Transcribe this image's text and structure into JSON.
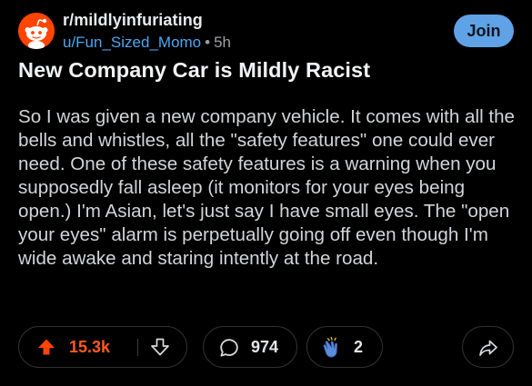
{
  "post": {
    "subreddit": "r/mildlyinfuriating",
    "author": "u/Fun_Sized_Momo",
    "separator": "•",
    "age": "5h",
    "join_label": "Join",
    "title": "New Company Car is Mildly Racist",
    "body": "So I was given a new company vehicle. It comes with all the bells and whistles, all the \"safety features\" one could ever need. One of these safety features is a warning when you supposedly fall asleep (it monitors for your eyes being open.) I'm Asian, let's just say I have small eyes. The \"open your eyes\" alarm is perpetually going off even though I'm wide awake and staring intently at the road."
  },
  "actions": {
    "upvotes": "15.3k",
    "comments": "974",
    "awards": "2"
  },
  "icons": {
    "avatar": "reddit-snoo-icon",
    "upvote": "upvote-arrow-icon",
    "downvote": "downvote-arrow-icon",
    "comment": "comment-bubble-icon",
    "award": "clapping-hands-icon",
    "share": "share-arrow-icon"
  },
  "colors": {
    "background": "#000000",
    "join_button": "#5FA3E6",
    "upvote_active": "#FF5A1F",
    "username": "#4FA6F0",
    "avatar": "#FF4500"
  }
}
